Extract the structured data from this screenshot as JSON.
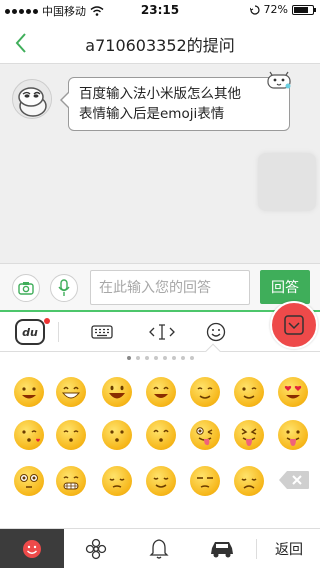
{
  "status_bar": {
    "carrier": "中国移动",
    "time": "23:15",
    "battery": "72%"
  },
  "nav": {
    "back_icon": "chevron-left-icon",
    "title": "a710603352的提问"
  },
  "question": {
    "text_line1": "百度输入法小米版怎么其他",
    "text_line2": "表情输入后是emoji表情"
  },
  "input_bar": {
    "placeholder": "在此输入您的回答",
    "submit_label": "回答"
  },
  "keyboard_toolbar": {
    "logo_text": "du",
    "icons": [
      "keyboard-icon",
      "cursor-icon",
      "smiley-icon",
      "collapse-icon"
    ]
  },
  "emoji_panel": {
    "page_count": 8,
    "current_page": 1,
    "rows": [
      [
        "smile",
        "grin",
        "big-smile",
        "happy",
        "blush",
        "wink",
        "heart-eyes"
      ],
      [
        "kiss-heart",
        "kiss-closed",
        "kiss",
        "kiss-smile",
        "tongue-wink",
        "tongue-squint",
        "tongue"
      ],
      [
        "flushed",
        "grimace",
        "pensive",
        "relieved",
        "unamused",
        "disappointed",
        "backspace"
      ]
    ]
  },
  "bottom_tabs": {
    "items": [
      "smiley-icon",
      "flower-icon",
      "bell-icon",
      "car-icon"
    ],
    "return_label": "返回",
    "active_index": 0
  },
  "colors": {
    "accent": "#3fae5a",
    "close_red": "#ee4a4a",
    "emoji_yellow": "#f6b619"
  }
}
